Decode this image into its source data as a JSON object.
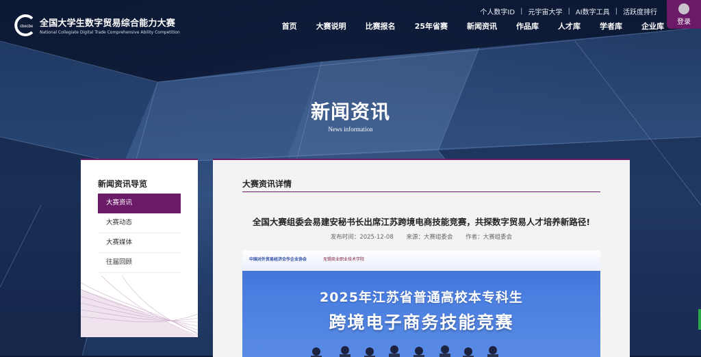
{
  "header": {
    "logo_mark": "cbecbe",
    "logo_cn": "全国大学生数字贸易综合能力大赛",
    "logo_en": "National Collegiate Digital Trade Comprehensive Ability Competition",
    "top_links": [
      "个人数字ID",
      "元宇宙大学",
      "AI数字工具",
      "活跃度排行"
    ],
    "login_label": "登录",
    "nav": [
      "首页",
      "大赛说明",
      "比赛报名",
      "25年省赛",
      "新闻资讯",
      "作品库",
      "人才库",
      "学者库",
      "企业库"
    ]
  },
  "hero": {
    "title": "新闻资讯",
    "subtitle": "News information"
  },
  "sidebar": {
    "title": "新闻资讯导览",
    "items": [
      "大赛资讯",
      "大赛动态",
      "大赛媒体",
      "往届回顾"
    ],
    "active_index": 0
  },
  "main": {
    "section_title": "大赛资讯详情",
    "article": {
      "title": "全国大赛组委会易建安秘书长出席江苏跨境电商技能竞赛，共探数字贸易人才培养新路径!",
      "date": "发布时间：2025-12-08",
      "source": "来源：大赛组委会",
      "author": "作者：大赛组委会"
    },
    "banner": {
      "org1": "中国对外贸易经济合作企业协会",
      "org2": "无锡商业职业技术学院",
      "line1": "2025年江苏省普通高校本专科生",
      "line2": "跨境电子商务技能竞赛"
    }
  },
  "colors": {
    "accent": "#6a1a67",
    "banner_blue": "#4a7ee0"
  }
}
